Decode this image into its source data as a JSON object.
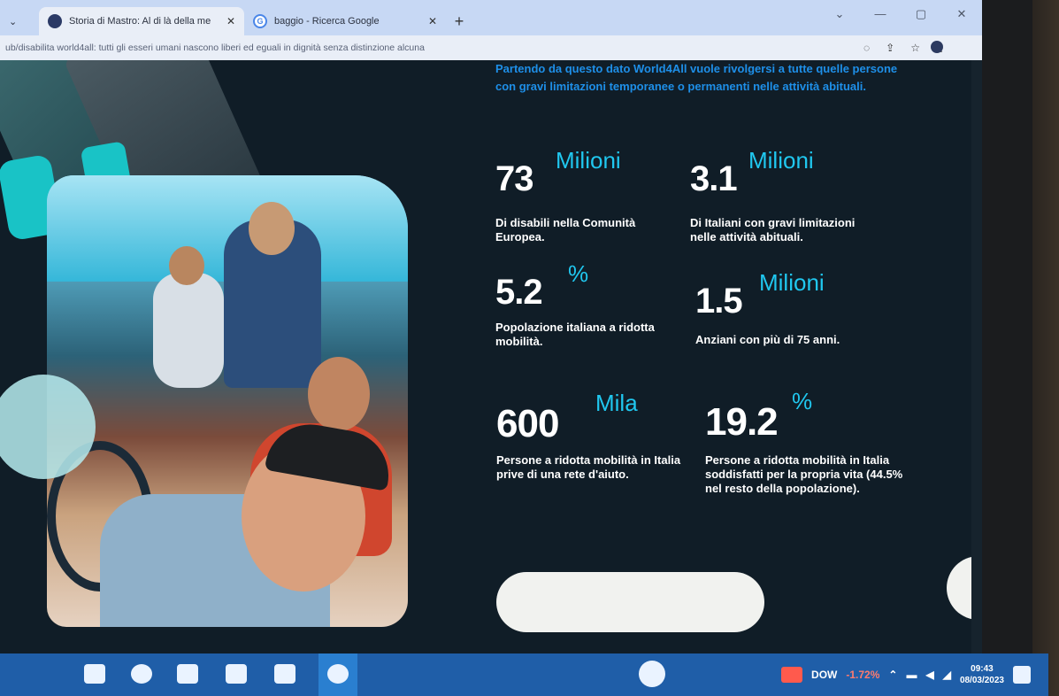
{
  "browser": {
    "tabs": [
      {
        "label": "Storia di Mastro: Al di là della me",
        "active": true,
        "icon": "edge-site-icon"
      },
      {
        "label": "baggio - Ricerca Google",
        "active": false,
        "icon": "google-icon"
      }
    ],
    "new_tab": "+",
    "url": "ub/disabilita world4all: tutti gli esseri umani nascono liberi ed eguali in dignità senza distinzione alcuna"
  },
  "page": {
    "intro_text": "Partendo da questo dato World4All vuole rivolgersi a tutte quelle persone con gravi limitazioni temporanee o permanenti nelle attività abituali.",
    "stats": [
      {
        "value": "73",
        "unit": "Milioni",
        "desc": "Di disabili nella Comunità Europea."
      },
      {
        "value": "3.1",
        "unit": "Milioni",
        "desc": "Di Italiani con gravi limitazioni nelle attività abituali."
      },
      {
        "value": "5.2",
        "unit": "%",
        "desc": "Popolazione italiana a ridotta mobilità."
      },
      {
        "value": "1.5",
        "unit": "Milioni",
        "desc": "Anziani con più di 75 anni."
      },
      {
        "value": "600",
        "unit": "Mila",
        "desc": "Persone a ridotta mobilità in Italia prive di una rete d'aiuto."
      },
      {
        "value": "19.2",
        "unit": "%",
        "desc": "Persone a ridotta mobilità in Italia soddisfatti per la propria vita (44.5% nel resto della popolazione)."
      }
    ]
  },
  "taskbar": {
    "stock_label": "DOW",
    "stock_change": "-1.72%",
    "time": "09:43",
    "date": "08/03/2023"
  },
  "colors": {
    "page_bg": "#101d27",
    "accent_cyan": "#20c7ef",
    "intro_blue": "#1e8fe8",
    "taskbar": "#1f5ea8"
  }
}
